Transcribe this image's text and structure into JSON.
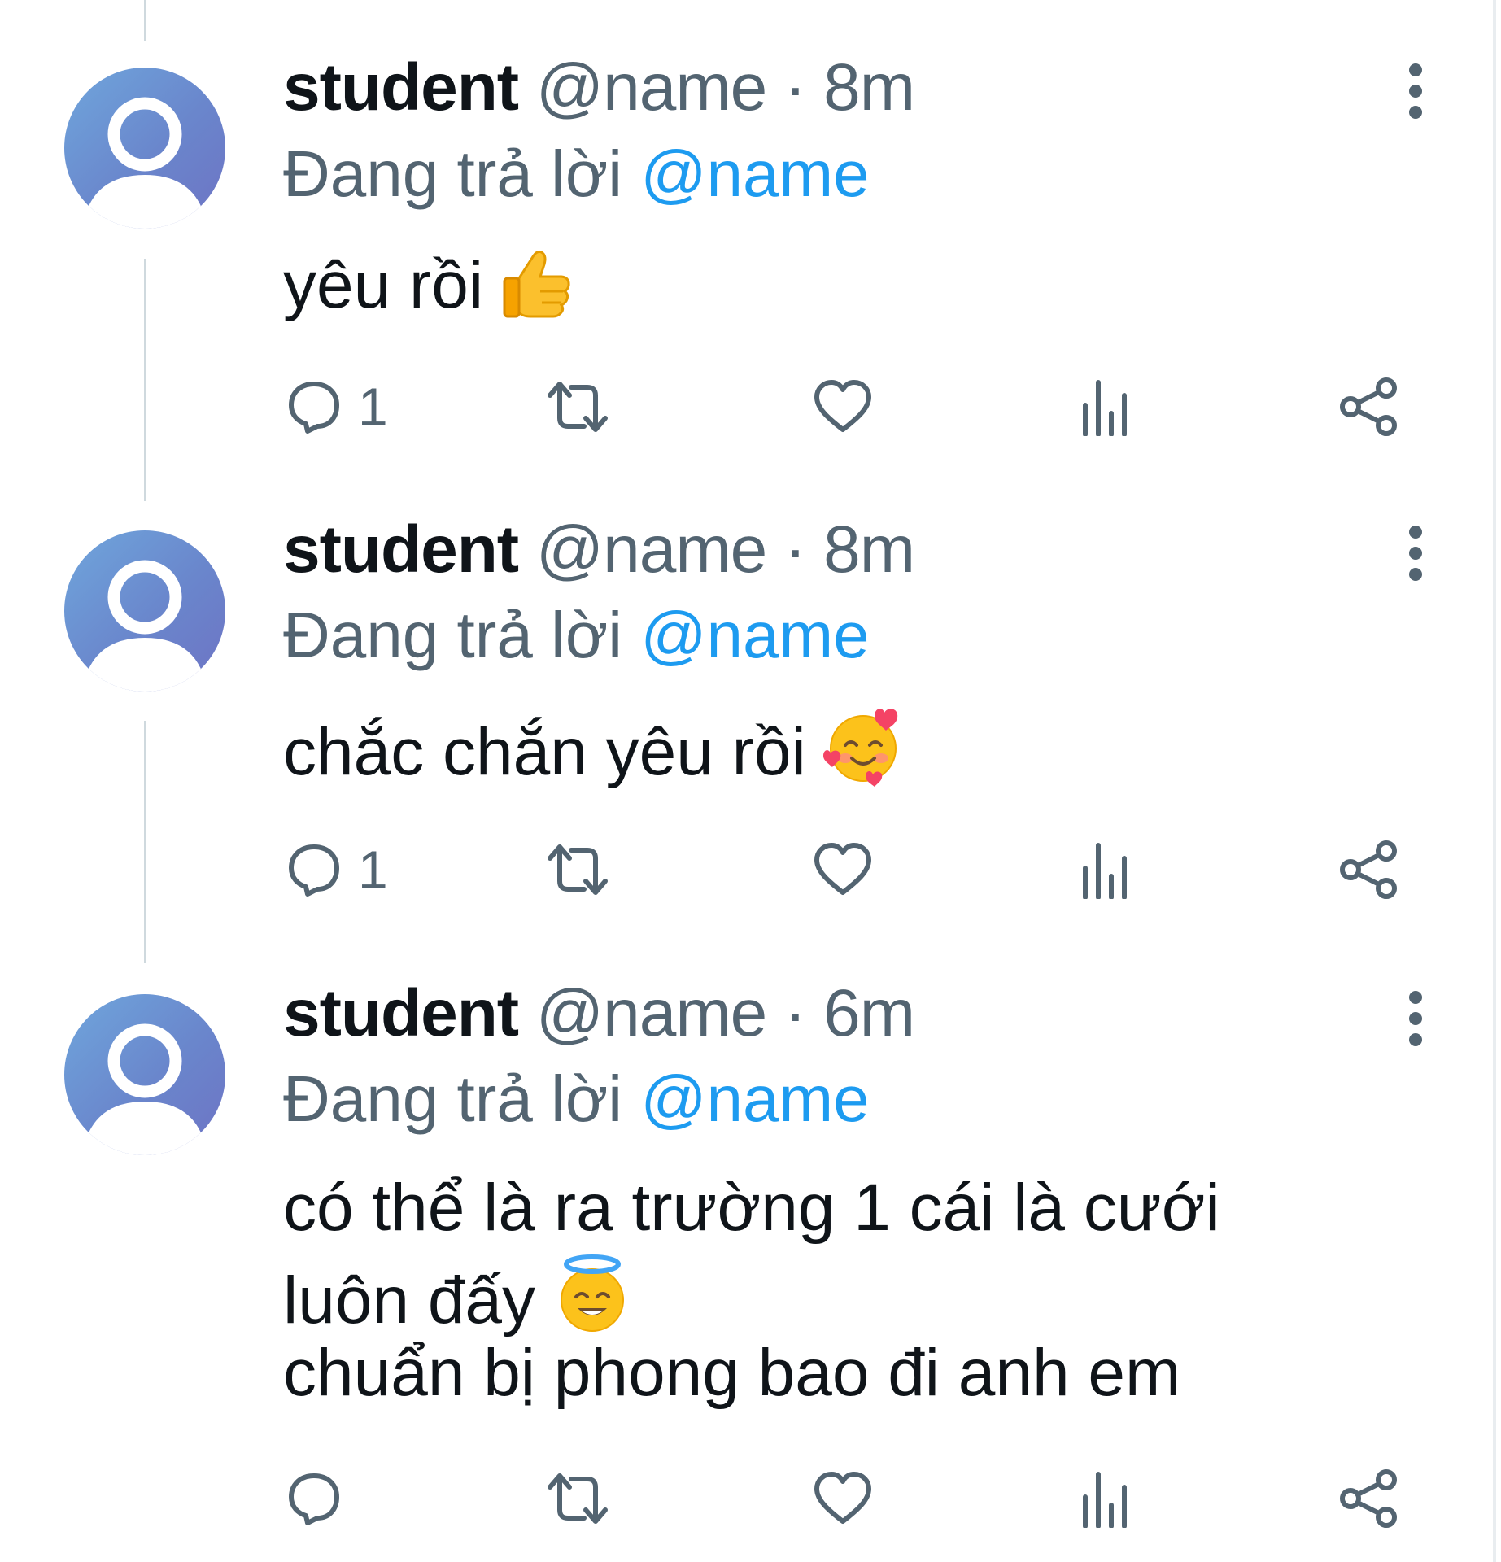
{
  "tweets": [
    {
      "display_name": "student",
      "handle": "@name",
      "separator": "·",
      "time": "8m",
      "reply_prefix": "Đang trả lời",
      "reply_to": "@name",
      "text_lines": [
        "yêu rồi"
      ],
      "emoji": "thumbs-up",
      "reply_count": "1"
    },
    {
      "display_name": "student",
      "handle": "@name",
      "separator": "·",
      "time": "8m",
      "reply_prefix": "Đang trả lời",
      "reply_to": "@name",
      "text_lines": [
        "chắc chắn yêu rồi"
      ],
      "emoji": "smiling-face-with-hearts",
      "reply_count": "1"
    },
    {
      "display_name": "student",
      "handle": "@name",
      "separator": "·",
      "time": "6m",
      "reply_prefix": "Đang trả lời",
      "reply_to": "@name",
      "text_lines": [
        "có thể là ra trường 1 cái là cưới",
        "luôn đấy",
        "chuẩn bị phong bao đi anh em"
      ],
      "emoji": "smiling-face-with-halo",
      "reply_count": ""
    }
  ],
  "icons": {
    "reply": "speech-bubble-icon",
    "retweet": "retweet-icon",
    "like": "heart-icon",
    "views": "bar-chart-icon",
    "share": "share-icon",
    "more": "more-vertical-icon"
  },
  "colors": {
    "text_primary": "#0f1419",
    "text_secondary": "#536471",
    "mention": "#1d9bf0",
    "thread_line": "#cfd9de",
    "avatar_gradient_start": "#6fa6dc",
    "avatar_gradient_end": "#6d73c4"
  }
}
